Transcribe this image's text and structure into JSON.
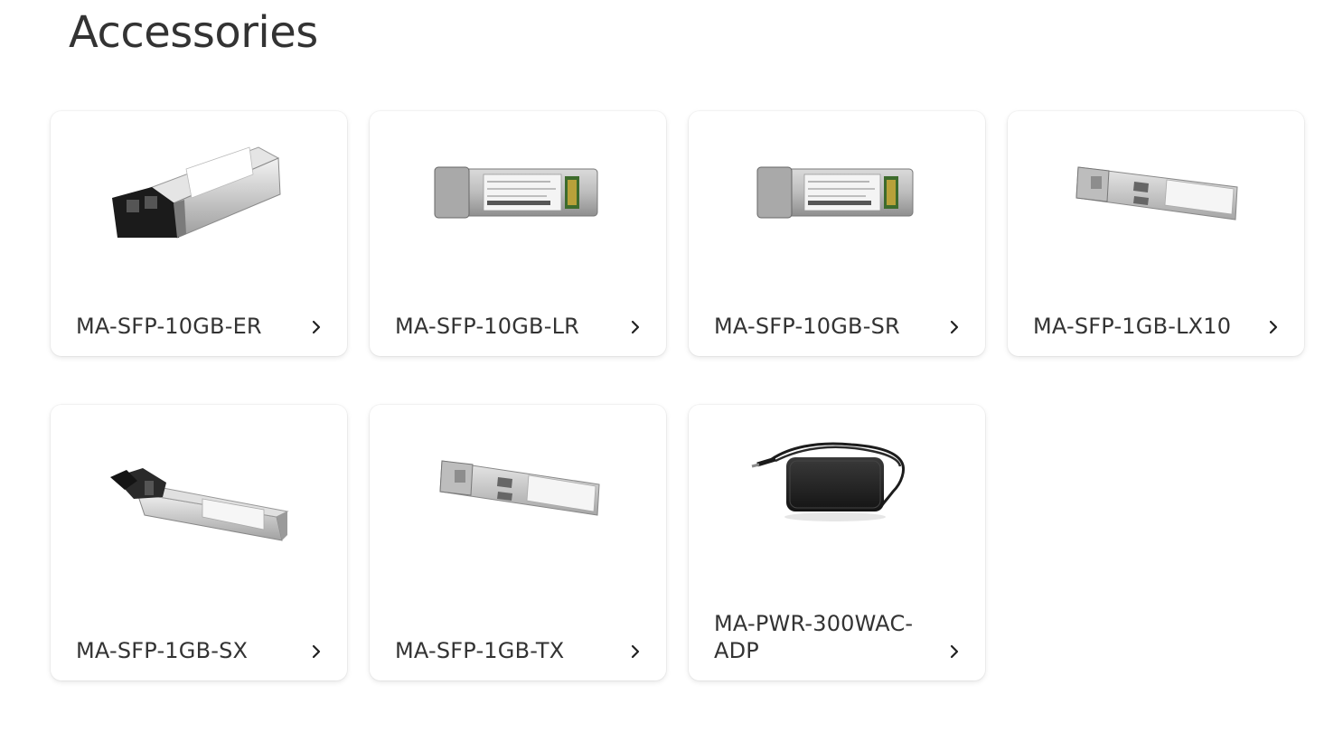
{
  "page": {
    "title": "Accessories"
  },
  "products": [
    {
      "name": "MA-SFP-10GB-ER",
      "icon": "chevron-right-icon"
    },
    {
      "name": "MA-SFP-10GB-LR",
      "icon": "chevron-right-icon"
    },
    {
      "name": "MA-SFP-10GB-SR",
      "icon": "chevron-right-icon"
    },
    {
      "name": "MA-SFP-1GB-LX10",
      "icon": "chevron-right-icon"
    },
    {
      "name": "MA-SFP-1GB-SX",
      "icon": "chevron-right-icon"
    },
    {
      "name": "MA-SFP-1GB-TX",
      "icon": "chevron-right-icon"
    },
    {
      "name": "MA-PWR-300WAC-ADP",
      "icon": "chevron-right-icon"
    }
  ],
  "colors": {
    "text": "#333333",
    "card_bg": "#ffffff",
    "page_bg": "#ffffff"
  }
}
